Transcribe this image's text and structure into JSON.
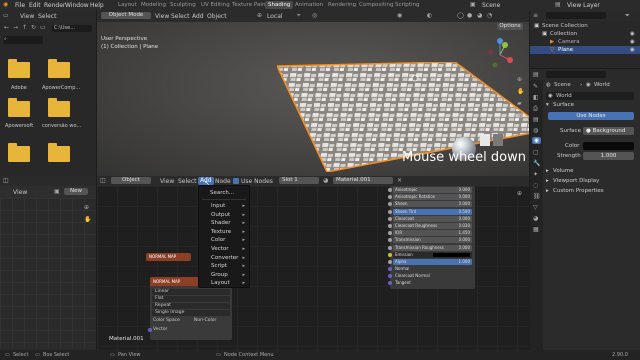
{
  "topbar": {
    "menu": [
      "File",
      "Edit",
      "Render",
      "Window",
      "Help"
    ],
    "workspaces": [
      "Layout",
      "Modeling",
      "Sculpting",
      "UV Editing",
      "Texture Paint",
      "Shading",
      "Animation",
      "Rendering",
      "Compositing",
      "Scripting"
    ],
    "active_workspace": "Shading",
    "scene": "Scene",
    "view_layer": "View Layer"
  },
  "filebrowser": {
    "header": [
      "View",
      "Select"
    ],
    "path": "C:\\Use...",
    "folders": [
      "Adobe",
      "ApowerComp...",
      "Apowersoft",
      "conversão wo...",
      "",
      ""
    ]
  },
  "viewport": {
    "mode": "Object Mode",
    "menus": [
      "View",
      "Select",
      "Add",
      "Object"
    ],
    "transform": "Local",
    "options": "Options",
    "info_line1": "User Perspective",
    "info_line2": "(1) Collection | Plane",
    "overlay_text": "Mouse wheel down"
  },
  "node_editor": {
    "editor_type": "Object",
    "menus": [
      "View",
      "Select",
      "Add",
      "Node"
    ],
    "use_nodes_label": "Use Nodes",
    "slot": "Slot 1",
    "material": "Material.001",
    "footer_material": "Material.001",
    "normal_map_title": "NORMAL MAP",
    "image_node_title": "NORMAL MAP",
    "image_rows": [
      "Linear",
      "Flat",
      "Repeat",
      "Single Image"
    ],
    "color_space_label": "Color Space",
    "color_space_value": "Non-Color",
    "vector_label": "Vector",
    "bsdf_rows": [
      {
        "label": "Anisotropic",
        "value": "0.000"
      },
      {
        "label": "Anisotropic Rotation",
        "value": "0.000"
      },
      {
        "label": "Sheen",
        "value": "0.000"
      },
      {
        "label": "Sheen Tint",
        "value": "0.500"
      },
      {
        "label": "Clearcoat",
        "value": "0.000"
      },
      {
        "label": "Clearcoat Roughness",
        "value": "0.030"
      },
      {
        "label": "IOR",
        "value": "1.450"
      },
      {
        "label": "Transmission",
        "value": "0.000"
      },
      {
        "label": "Transmission Roughness",
        "value": "0.000"
      },
      {
        "label": "Emission",
        "value": ""
      },
      {
        "label": "Alpha",
        "value": "1.000"
      }
    ],
    "bsdf_outputs": [
      "Normal",
      "Clearcoat Normal",
      "Tangent"
    ]
  },
  "add_menu": {
    "search": "Search...",
    "items": [
      "Input",
      "Output",
      "Shader",
      "Texture",
      "Color",
      "Vector",
      "Converter",
      "Script",
      "Group",
      "Layout"
    ]
  },
  "left_lower": {
    "header": [
      "View"
    ],
    "new_label": "New"
  },
  "outliner": {
    "rows": [
      "Scene Collection",
      "Collection",
      "Camera",
      "Plane"
    ]
  },
  "properties": {
    "scene": "Scene",
    "world_tab": "World",
    "world_name": "World",
    "surface_section": "Surface",
    "use_nodes": "Use Nodes",
    "surface_label": "Surface",
    "surface_value": "Background",
    "color_label": "Color",
    "strength_label": "Strength",
    "strength_value": "1.000",
    "sections": [
      "Volume",
      "Viewport Display",
      "Custom Properties"
    ]
  },
  "statusbar": {
    "items": [
      "Select",
      "Box Select",
      "Pan View",
      "Node Context Menu"
    ],
    "version": "2.90.0"
  },
  "colors": {
    "accent": "#4772b3",
    "active_outline": "#f58e1f",
    "folder": "#e6b53a"
  }
}
